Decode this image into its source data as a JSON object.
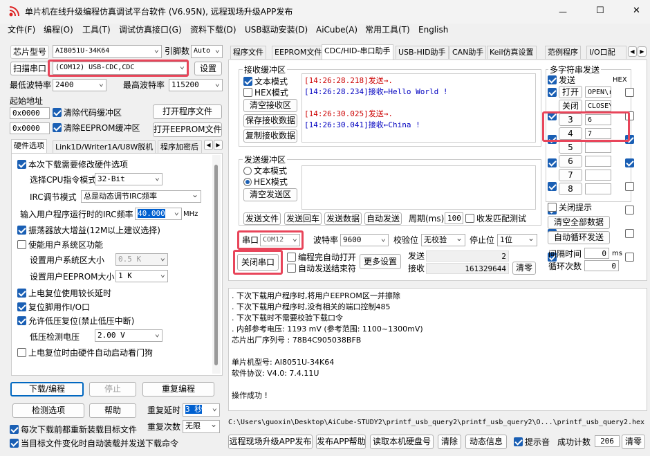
{
  "titlebar": {
    "title": "单片机在线升级编程仿真调试平台软件 (V6.95N), 远程现场升级APP发布",
    "min": "—",
    "max": "☐",
    "close": "✕"
  },
  "menu": [
    "文件(F)",
    "编程(O)",
    "工具(T)",
    "调试仿真接口(G)",
    "资料下载(D)",
    "USB驱动安装(D)",
    "AiCube(A)",
    "常用工具(T)",
    "English"
  ],
  "left": {
    "chip_label": "芯片型号",
    "chip_value": "AI8051U-34K64",
    "pin_label": "引脚数",
    "pin_value": "Auto",
    "scan_label": "扫描串口",
    "port_value": "(COM12) USB-CDC,CDC",
    "settings": "设置",
    "min_baud_label": "最低波特率",
    "min_baud": "2400",
    "max_baud_label": "最高波特率",
    "max_baud": "115200",
    "start_addr_label": "起始地址",
    "addr1": "0x0000",
    "clear_code": "清除代码缓冲区",
    "open_prog": "打开程序文件",
    "addr2": "0x0000",
    "clear_eeprom": "清除EEPROM缓冲区",
    "open_eeprom": "打开EEPROM文件",
    "tabs": [
      "硬件选项",
      "Link1D/Writer1A/U8W脱机",
      "程序加密后"
    ],
    "options": {
      "modify_hw": "本次下载需要修改硬件选项",
      "cpu_label": "选择CPU指令模式",
      "cpu_value": "32-Bit",
      "irc_label": "IRC调节模式",
      "irc_value": "总是动态调节IRC频率",
      "freq_label": "输入用户程序运行时的IRC频率",
      "freq_value": "40.000",
      "freq_unit": "MHz",
      "osc": "振荡器放大增益(12M以上建议选择)",
      "sysram": "使能用户系统区功能",
      "sysram_size_label": "设置用户系统区大小",
      "sysram_size": "0.5 K",
      "eeprom_size_label": "设置用户EEPROM大小",
      "eeprom_size": "1   K",
      "por_delay": "上电复位使用较长延时",
      "reset_io": "复位脚用作I/O口",
      "lvr": "允许低压复位(禁止低压中断)",
      "lvd_label": "低压检测电压",
      "lvd_value": "2.00 V",
      "wdt": "上电复位时由硬件自动启动看门狗"
    },
    "download": "下载/编程",
    "stop": "停止",
    "reprogram": "重复编程",
    "check": "检测选项",
    "help": "帮助",
    "repeat_delay_label": "重复延时",
    "repeat_delay": "3 秒",
    "repeat_count_label": "重复次数",
    "repeat_count": "无限",
    "reload_each": "每次下载前都重新装载目标文件",
    "auto_send": "当目标文件变化时自动装载并发送下载命令"
  },
  "right_tabs": [
    "程序文件",
    "EEPROM文件",
    "CDC/HID-串口助手",
    "USB-HID助手",
    "CAN助手",
    "Keil仿真设置",
    "范例程序",
    "I/O口配"
  ],
  "recv": {
    "title": "接收缓冲区",
    "text_mode": "文本模式",
    "hex_mode": "HEX模式",
    "clear": "清空接收区",
    "save": "保存接收数据",
    "copy": "复制接收数据",
    "lines": [
      {
        "ts": "[14:26:28.218]",
        "dir": "发送→",
        "msg": "."
      },
      {
        "ts": "[14:26:28.234]",
        "dir": "接收←",
        "msg": "Hello World !"
      },
      {
        "ts": "",
        "dir": "",
        "msg": ""
      },
      {
        "ts": "[14:26:30.025]",
        "dir": "发送→",
        "msg": "."
      },
      {
        "ts": "[14:26:30.041]",
        "dir": "接收←",
        "msg": "China !"
      }
    ]
  },
  "send": {
    "title": "发送缓冲区",
    "text_mode": "文本模式",
    "hex_mode": "HEX模式",
    "clear": "清空发送区",
    "send_file": "发送文件",
    "send_return": "发送回车",
    "send_data": "发送数据",
    "auto_send": "自动发送",
    "period_label": "周期(ms)",
    "period": "100",
    "match": "收发匹配测试"
  },
  "serial": {
    "port_label": "串口",
    "port": "COM12",
    "baud_label": "波特率",
    "baud": "9600",
    "parity_label": "校验位",
    "parity": "无校验",
    "stop_label": "停止位",
    "stop": "1位",
    "close_port": "关闭串口",
    "auto_open": "编程完自动打开",
    "auto_close": "自动发送结束符",
    "more": "更多设置",
    "sent_label": "发送",
    "sent": "2",
    "recv_label": "接收",
    "recv": "161329644",
    "clear": "清零"
  },
  "multi": {
    "title": "多字符串发送",
    "send": "发送",
    "hex": "HEX",
    "rows": [
      {
        "label": "打开",
        "value": "OPEN\\r",
        "chk": true,
        "hex": false
      },
      {
        "label": "关闭",
        "value": "CLOSE\\",
        "chk": true,
        "hex": false
      },
      {
        "label": "3",
        "value": "6",
        "chk": true,
        "hex": true
      },
      {
        "label": "4",
        "value": "7",
        "chk": true,
        "hex": true
      },
      {
        "label": "5",
        "value": "",
        "chk": true,
        "hex": false
      },
      {
        "label": "6",
        "value": "",
        "chk": true,
        "hex": false
      },
      {
        "label": "7",
        "value": "",
        "chk": true,
        "hex": false
      },
      {
        "label": "8",
        "value": "",
        "chk": true,
        "hex": false
      }
    ],
    "close_hint": "关闭提示",
    "clear_all": "清空全部数据",
    "auto_loop": "自动循环发送",
    "interval_label": "间隔时间",
    "interval": "0",
    "interval_unit": "ms",
    "loop_label": "循环次数",
    "loop": "0"
  },
  "log": [
    "  . 下次下载用户程序时,将用户EEPROM区一并擦除",
    "  . 下次下载用户程序时,没有相关的端口控制485",
    "  . 下次下载时不需要校验下载口令",
    "  . 内部参考电压: 1193 mV (参考范围: 1100~1300mV)",
    "芯片出厂序列号 : 78B4C905038BFB",
    "",
    "  单片机型号: AI8051U-34K64",
    "  软件协议: V4.0: 7.4.11U",
    "",
    "操作成功 !"
  ],
  "path": "C:\\Users\\guoxin\\Desktop\\AiCube-STUDY2\\printf_usb_query2\\printf_usb_query2\\O...\\printf_usb_query2.hex",
  "bottom": {
    "publish_app": "远程现场升级APP发布",
    "publish_help": "发布APP帮助",
    "read_disk": "读取本机硬盘号",
    "clear": "清除",
    "dynamic": "动态信息",
    "beep": "提示音",
    "success_label": "成功计数",
    "success": "206",
    "reset": "清零"
  }
}
